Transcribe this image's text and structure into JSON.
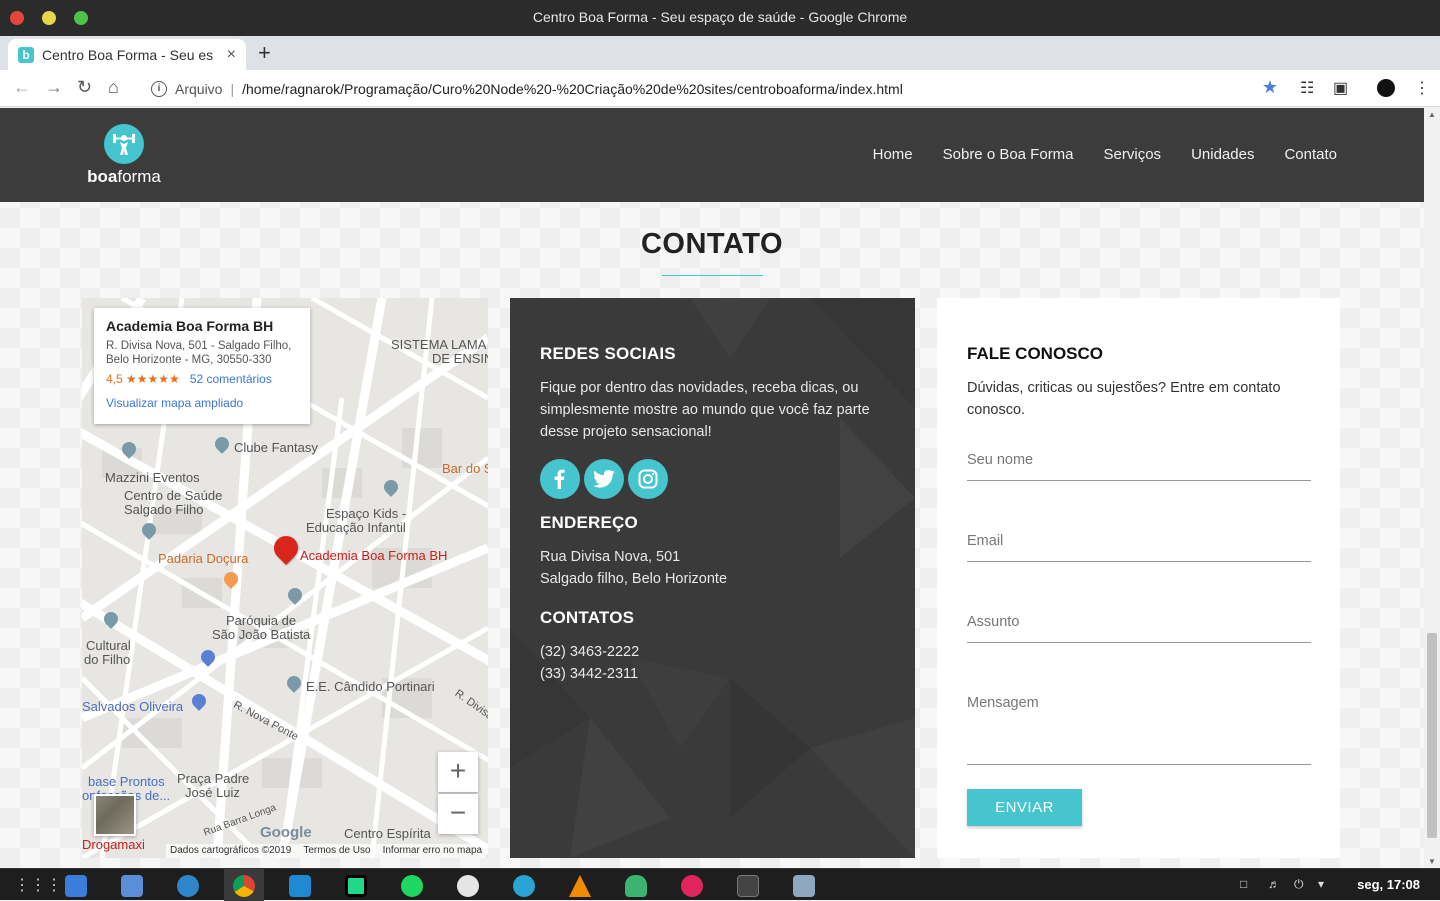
{
  "window": {
    "title": "Centro Boa Forma - Seu espaço de saúde - Google Chrome",
    "tab_title": "Centro Boa Forma - Seu es",
    "favicon_letter": "b",
    "new_tab": "+",
    "tab_close": "×"
  },
  "toolbar": {
    "protocol_label": "Arquivo",
    "url": "/home/ragnarok/Programação/Curo%20Node%20-%20Criação%20de%20sites/centroboaforma/index.html",
    "icons": [
      "back-icon",
      "forward-icon",
      "reload-icon",
      "home-icon",
      "info-icon",
      "bookmark-star-icon",
      "extension-icon",
      "cast-icon",
      "profile-avatar-icon",
      "menu-icon"
    ]
  },
  "site": {
    "logo_bold": "boa",
    "logo_rest": "forma",
    "nav": [
      "Home",
      "Sobre o Boa Forma",
      "Serviços",
      "Unidades",
      "Contato"
    ],
    "section_title": "CONTATO",
    "accent": "#46c5cf"
  },
  "map": {
    "place_name": "Academia Boa Forma BH",
    "address_line1": "R. Divisa Nova, 501 - Salgado Filho,",
    "address_line2": "Belo Horizonte - MG, 30550-330",
    "rating": "4,5 ★★★★★",
    "reviews": "52 comentários",
    "enlarge_link": "Visualizar mapa ampliado",
    "labels": {
      "sistema1": "SISTEMA LAMA",
      "sistema2": "DE ENSIN",
      "clube": "Clube Fantasy",
      "bar": "Bar do S",
      "mazzini": "Mazzini Eventos",
      "saude1": "Centro de Saúde",
      "saude2": "Salgado Filho",
      "espaco1": "Espaço Kids -",
      "espaco2": "Educação Infantil",
      "padaria": "Padaria Doçura",
      "academia": "Academia Boa Forma BH",
      "paroquia1": "Paróquia de",
      "paroquia2": "São João Batista",
      "cultural1": "Cultural",
      "cultural2": "do Filho",
      "portinari": "E.E. Cândido Portinari",
      "salvados": "Salvados Oliveira",
      "novaponte": "R. Nova Ponte",
      "divisa": "R. Divisa",
      "base1": "base Prontos",
      "base2": "onfecções de...",
      "praca1": "Praça Padre",
      "praca2": "José Luiz",
      "barralonga": "Rua Barra Longa",
      "espirita": "Centro Espírita",
      "drogamaxi": "Drogamaxi"
    },
    "zoom_in": "+",
    "zoom_out": "−",
    "google": "Google",
    "footer": [
      "Dados cartográficos ©2019",
      "Termos de Uso",
      "Informar erro no mapa"
    ]
  },
  "social": {
    "heading": "REDES SOCIAIS",
    "text": "Fique por dentro das novidades, receba dicas, ou simplesmente mostre ao mundo que você faz parte desse projeto sensacional!",
    "icons": [
      "facebook-icon",
      "twitter-icon",
      "instagram-icon"
    ],
    "address_heading": "ENDEREÇO",
    "address_line1": "Rua Divisa Nova, 501",
    "address_line2": "Salgado filho, Belo Horizonte",
    "contacts_heading": "CONTATOS",
    "phone1": "(32) 3463-2222",
    "phone2": "(33) 3442-2311"
  },
  "form": {
    "heading": "FALE CONOSCO",
    "intro": "Dúvidas, criticas ou sujestões? Entre em contato conosco.",
    "name_placeholder": "Seu nome",
    "email_placeholder": "Email",
    "subject_placeholder": "Assunto",
    "message_placeholder": "Mensagem",
    "submit": "ENVIAR"
  },
  "taskbar": {
    "apps": [
      "apps-grid-icon",
      "files-icon",
      "file-manager-icon",
      "settings-icon",
      "chrome-icon",
      "vscode-icon",
      "pycharm-icon",
      "spotify-icon",
      "inkscape-icon",
      "download-icon",
      "vlc-icon",
      "cloud-icon",
      "flickr-icon",
      "terminal-icon",
      "video-icon"
    ],
    "clock": "seg, 17:08"
  }
}
